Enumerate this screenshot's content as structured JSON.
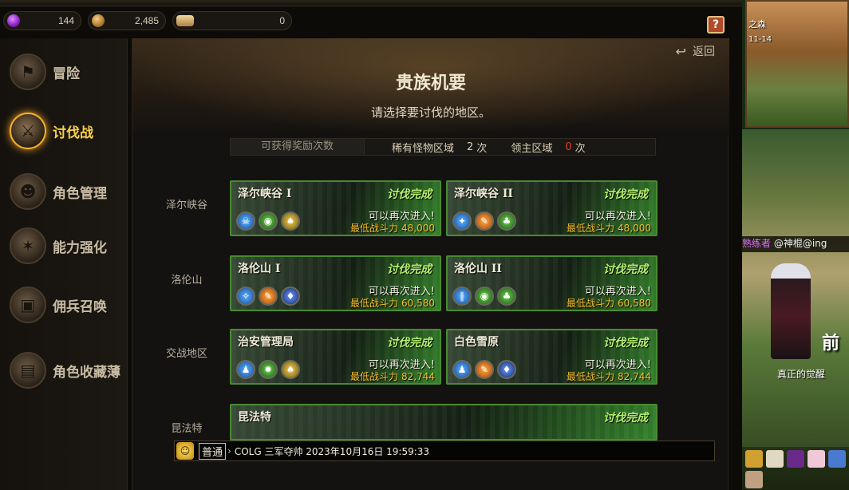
{
  "currencies": [
    {
      "icon": "purple-gem-icon",
      "value": "144"
    },
    {
      "icon": "gold-coin-icon",
      "value": "2,485"
    },
    {
      "icon": "gold-bar-icon",
      "value": "0"
    }
  ],
  "help_icon_text": "?",
  "sidebar": {
    "items": [
      {
        "icon": "adventure-icon",
        "label": "冒险"
      },
      {
        "icon": "crusade-icon",
        "label": "讨伐战"
      },
      {
        "icon": "character-manage-icon",
        "label": "角色管理"
      },
      {
        "icon": "enhance-icon",
        "label": "能力强化"
      },
      {
        "icon": "mercenary-summon-icon",
        "label": "佣兵召唤"
      },
      {
        "icon": "character-collection-icon",
        "label": "角色收藏薄"
      }
    ]
  },
  "header": {
    "back_label": "返回",
    "title": "贵族机要",
    "subtitle": "请选择要讨伐的地区。"
  },
  "reward_bar": {
    "label": "可获得奖励次数",
    "rare_label": "稀有怪物区域",
    "rare_count": "2",
    "boss_label": "领主区域",
    "boss_count": "0",
    "unit": "次"
  },
  "regions": [
    {
      "name": "泽尔峡谷",
      "cards": [
        {
          "name": "泽尔峡谷 I",
          "status": "讨伐完成",
          "reentry": "可以再次进入!",
          "min_label": "最低战斗力",
          "min_power": "48,000",
          "elements": [
            "water",
            "poison",
            "light"
          ]
        },
        {
          "name": "泽尔峡谷 II",
          "status": "讨伐完成",
          "reentry": "可以再次进入!",
          "min_label": "最低战斗力",
          "min_power": "48,000",
          "elements": [
            "water",
            "fire",
            "poison"
          ]
        }
      ]
    },
    {
      "name": "洛伦山",
      "cards": [
        {
          "name": "洛伦山 I",
          "status": "讨伐完成",
          "reentry": "可以再次进入!",
          "min_label": "最低战斗力",
          "min_power": "60,580",
          "elements": [
            "water",
            "fire",
            "dark"
          ]
        },
        {
          "name": "洛伦山 II",
          "status": "讨伐完成",
          "reentry": "可以再次进入!",
          "min_label": "最低战斗力",
          "min_power": "60,580",
          "elements": [
            "water",
            "poison",
            "poison"
          ]
        }
      ]
    },
    {
      "name": "交战地区",
      "cards": [
        {
          "name": "治安管理局",
          "status": "讨伐完成",
          "reentry": "可以再次进入!",
          "min_label": "最低战斗力",
          "min_power": "82,744",
          "elements": [
            "water",
            "poison",
            "light"
          ]
        },
        {
          "name": "白色雪原",
          "status": "讨伐完成",
          "reentry": "可以再次进入!",
          "min_label": "最低战斗力",
          "min_power": "82,744",
          "elements": [
            "water",
            "fire",
            "dark"
          ]
        }
      ]
    },
    {
      "name": "昆法特",
      "cards": [
        {
          "name": "昆法特",
          "status": "讨伐完成"
        }
      ]
    }
  ],
  "chat": {
    "channel": "普通",
    "message": "COLG 三军夺帅 2023年10月16日 19:59:33"
  },
  "game_view": {
    "map_name": "之森",
    "map_level": "11-14",
    "player_title": "熟练者",
    "player_name": "@神棍@ing",
    "banner_text": "前",
    "awaken_text": "真正的觉醒"
  }
}
